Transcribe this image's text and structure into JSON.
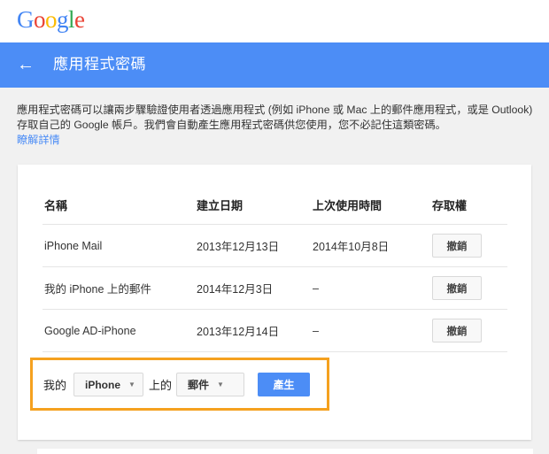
{
  "logo": {
    "letters": [
      "G",
      "o",
      "o",
      "g",
      "l",
      "e"
    ],
    "colors": [
      "#4285f4",
      "#ea4335",
      "#fbbc05",
      "#4285f4",
      "#34a853",
      "#ea4335"
    ]
  },
  "header": {
    "back_glyph": "←",
    "title": "應用程式密碼"
  },
  "description": {
    "text": "應用程式密碼可以讓兩步驟驗證使用者透過應用程式 (例如 iPhone 或 Mac 上的郵件應用程式，或是 Outlook) 存取自己的 Google 帳戶。我們會自動產生應用程式密碼供您使用，您不必記住這類密碼。",
    "learn_more": "瞭解詳情"
  },
  "table": {
    "headers": {
      "name": "名稱",
      "created": "建立日期",
      "last_used": "上次使用時間",
      "access": "存取權"
    },
    "rows": [
      {
        "name": "iPhone Mail",
        "created": "2013年12月13日",
        "last_used": "2014年10月8日",
        "action": "撤銷"
      },
      {
        "name": "我的 iPhone 上的郵件",
        "created": "2014年12月3日",
        "last_used": "–",
        "action": "撤銷"
      },
      {
        "name": "Google AD-iPhone",
        "created": "2013年12月14日",
        "last_used": "–",
        "action": "撤銷"
      }
    ]
  },
  "generator": {
    "prefix": "我的",
    "device_value": "iPhone",
    "middle": "上的",
    "app_value": "郵件",
    "generate_label": "產生",
    "highlight_color": "#f5a11f"
  },
  "colors": {
    "accent": "#4c8df6",
    "page_bg": "#f1f1f1"
  }
}
